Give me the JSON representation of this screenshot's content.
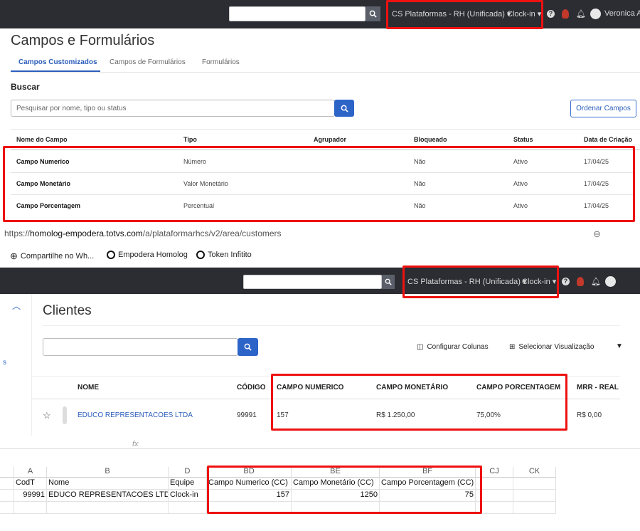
{
  "panel1": {
    "topbar": {
      "workspace": "CS Plataformas - RH (Unificada)",
      "clockin": "Clock-in",
      "user_name": "Veronica Ar",
      "icons": [
        "search-icon",
        "help-icon",
        "avatar-icon",
        "bell-icon",
        "user-avatar"
      ]
    },
    "page_title": "Campos e Formulários",
    "tabs": [
      {
        "label": "Campos Customizados",
        "active": true
      },
      {
        "label": "Campos de Formulários",
        "active": false
      },
      {
        "label": "Formulários",
        "active": false
      }
    ],
    "search": {
      "label": "Buscar",
      "placeholder": "Pesquisar por nome, tipo ou status",
      "order_button": "Ordenar Campos"
    },
    "table": {
      "headers": [
        "Nome do Campo",
        "Tipo",
        "Agrupador",
        "Bloqueado",
        "Status",
        "Data de Criação"
      ],
      "rows": [
        {
          "name": "Campo Numerico",
          "type": "Número",
          "group": "",
          "blocked": "Não",
          "status": "Ativo",
          "date": "17/04/25"
        },
        {
          "name": "Campo Monetário",
          "type": "Valor Monetário",
          "group": "",
          "blocked": "Não",
          "status": "Ativo",
          "date": "17/04/25"
        },
        {
          "name": "Campo Porcentagem",
          "type": "Percentual",
          "group": "",
          "blocked": "Não",
          "status": "Ativo",
          "date": "17/04/25"
        }
      ]
    }
  },
  "panel2": {
    "url": {
      "prefix": "https://",
      "host": "homolog-empodera.totvs.com",
      "path": "/a/plataformarhcs/v2/area/customers"
    },
    "bookmarks": [
      "Compartilhe no Wh...",
      "Empodera Homolog",
      "Token Infitito"
    ],
    "topbar": {
      "workspace": "CS Plataformas - RH (Unificada)",
      "clockin": "Clock-in"
    },
    "sidebar_letter": "s",
    "page_title": "Clientes",
    "toolbar": {
      "configure_columns": "Configurar Colunas",
      "select_view": "Selecionar Visualização"
    },
    "table": {
      "headers": [
        "NOME",
        "CÓDIGO",
        "CAMPO NUMERICO",
        "CAMPO MONETÁRIO",
        "CAMPO PORCENTAGEM",
        "MRR - REAL ("
      ],
      "row": {
        "name": "EDUCO REPRESENTACOES LTDA",
        "code": "99991",
        "numeric": "157",
        "monetary": "R$ 1.250,00",
        "percent": "75,00%",
        "mrr": "R$ 0,00"
      }
    }
  },
  "panel3": {
    "formula_bar_fx": "fx",
    "col_letters": [
      "A",
      "B",
      "D",
      "BD",
      "BE",
      "BF",
      "CJ",
      "CK"
    ],
    "header_row": [
      "CodT",
      "Nome",
      "Equipe",
      "Campo Numerico (CC)",
      "Campo Monetário (CC)",
      "Campo Porcentagem (CC)",
      "",
      ""
    ],
    "data_row": [
      "99991",
      "EDUCO REPRESENTACOES LTDA",
      "Clock-in",
      "157",
      "1250",
      "75",
      "",
      ""
    ]
  },
  "colors": {
    "topbar": "#2b2d33",
    "accent_blue": "#2d64c8",
    "highlight_red": "#e11111"
  }
}
